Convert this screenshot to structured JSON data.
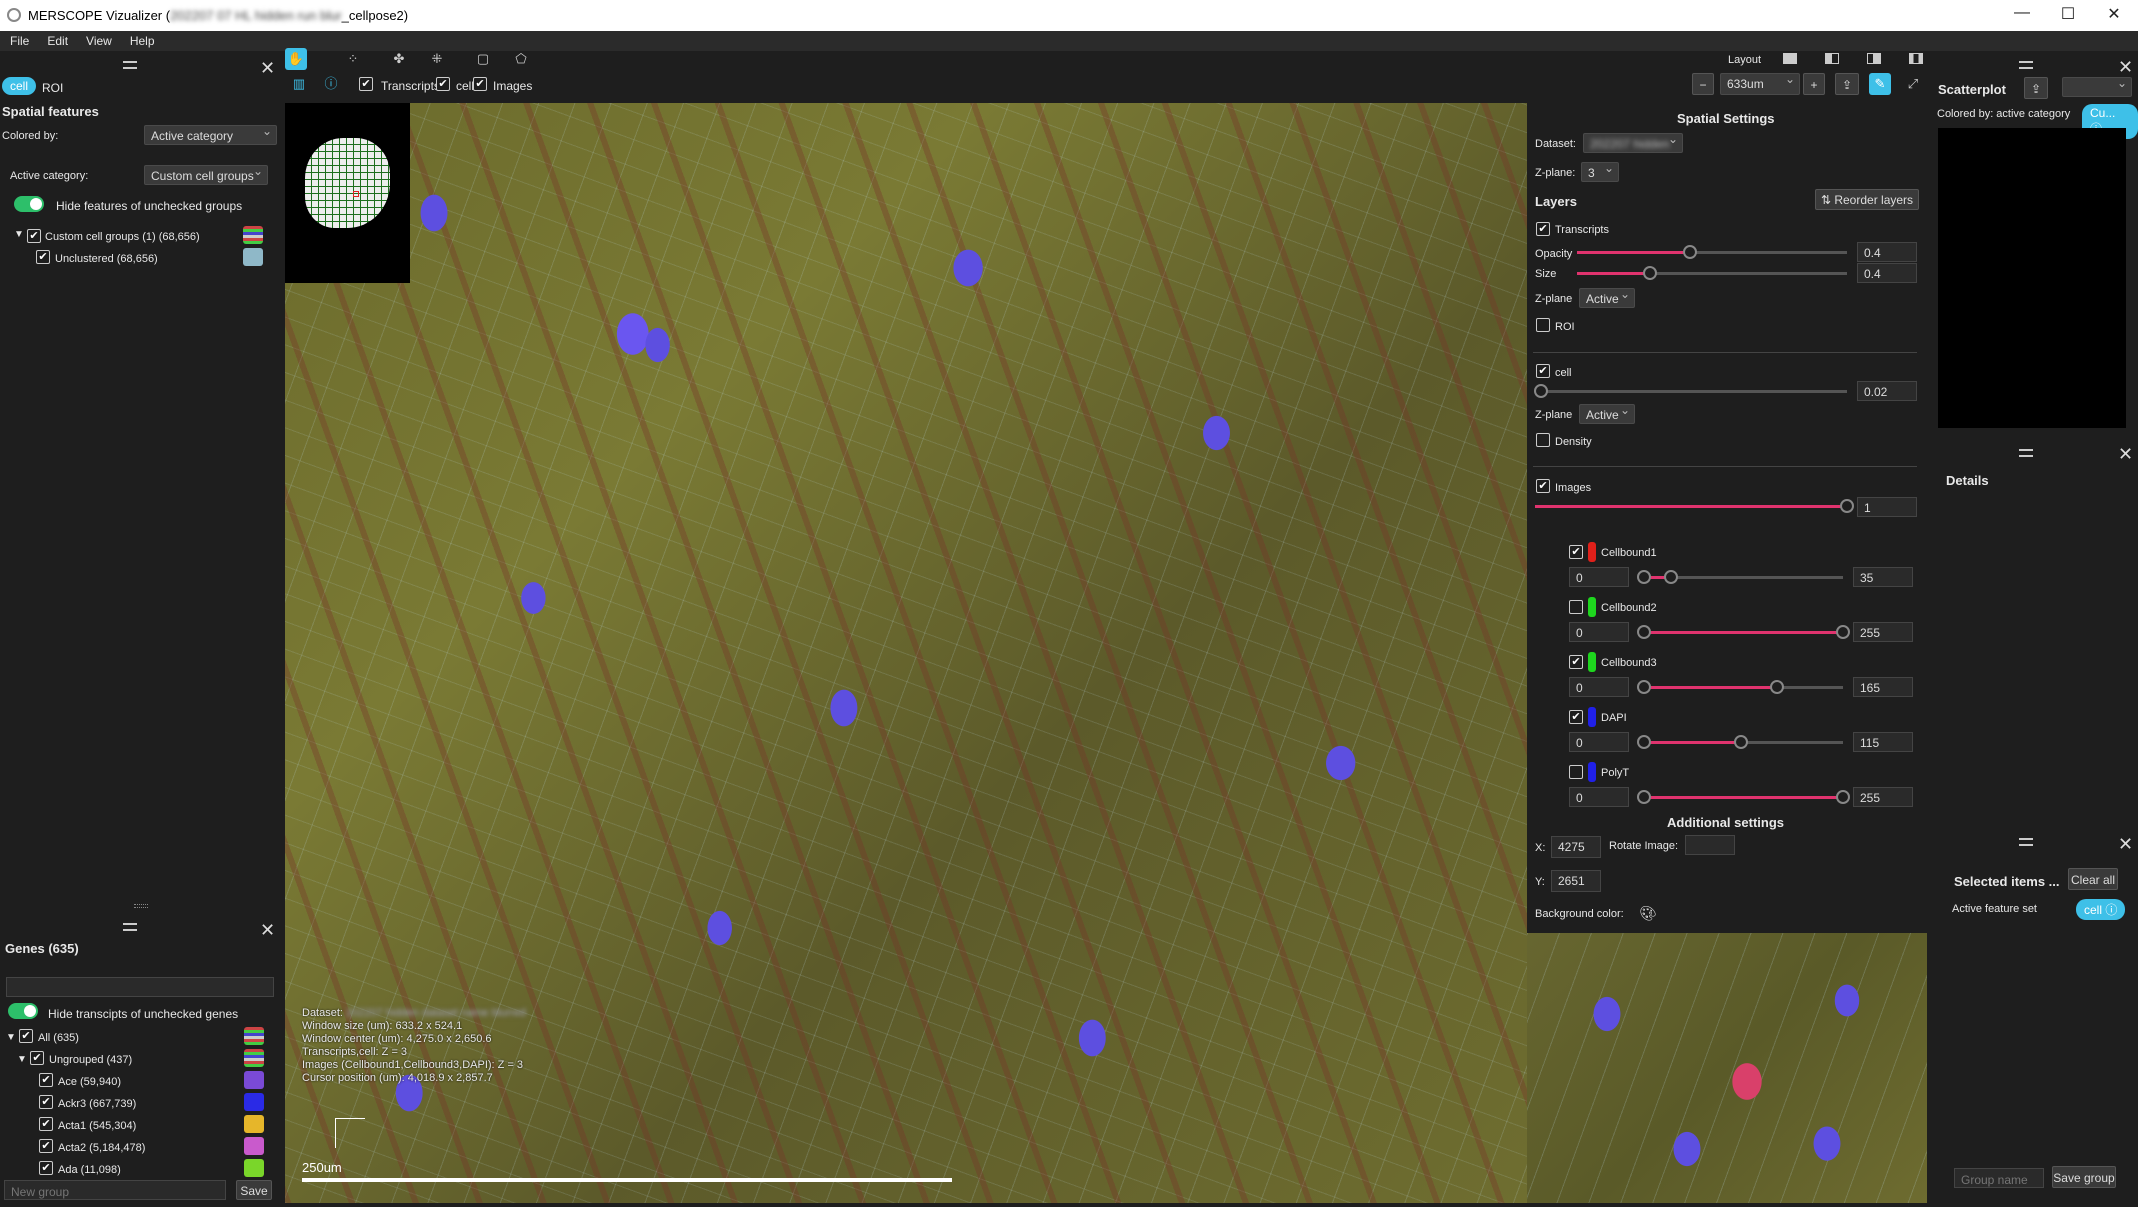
{
  "window": {
    "title_prefix": "MERSCOPE Vizualizer (",
    "title_blurred": "202207 07 HL hidden run blur",
    "title_suffix": "_cellpose2)",
    "minimize": "—",
    "maximize": "☐",
    "close": "✕"
  },
  "menu": [
    "File",
    "Edit",
    "View",
    "Help"
  ],
  "left": {
    "tabs": {
      "cell": "cell",
      "roi": "ROI"
    },
    "spatial_features": "Spatial features",
    "colored_by_label": "Colored by:",
    "colored_by_value": "Active category",
    "active_category_label": "Active category:",
    "active_category_value": "Custom cell groups",
    "hide_features": "Hide features of unchecked groups",
    "tree": [
      {
        "label": "Custom cell groups (1) (68,656)"
      },
      {
        "label": "Unclustered (68,656)",
        "color": "#8fb8c8"
      }
    ]
  },
  "genes": {
    "title": "Genes (635)",
    "search_placeholder": "",
    "hide_label": "Hide transcipts of unchecked genes",
    "rows": [
      {
        "label": "All (635)",
        "color": ""
      },
      {
        "label": "Ungrouped (437)",
        "color": ""
      },
      {
        "label": "Ace (59,940)",
        "color": "#7a4ad6"
      },
      {
        "label": "Ackr3 (667,739)",
        "color": "#2a2ae6"
      },
      {
        "label": "Acta1 (545,304)",
        "color": "#e6b62a"
      },
      {
        "label": "Acta2 (5,184,478)",
        "color": "#c95acc"
      },
      {
        "label": "Ada (11,098)",
        "color": "#7ad62a"
      }
    ],
    "new_group_placeholder": "New group",
    "save": "Save"
  },
  "toolbar": {
    "transcripts": "Transcripts",
    "cell": "cell",
    "images": "Images",
    "layout": "Layout",
    "zoom_value": "633um",
    "minus": "−",
    "plus": "+"
  },
  "viewer": {
    "overlay": [
      {
        "k": "Dataset:",
        "v": "202207 hidden dataset name blurred"
      },
      {
        "k": "Window size (um): 633.2 x 524.1",
        "v": ""
      },
      {
        "k": "Window center (um): 4,275.0 x 2,650.6",
        "v": ""
      },
      {
        "k": "Transcripts,cell: Z = 3",
        "v": ""
      },
      {
        "k": "Images (Cellbound1,Cellbound3,DAPI): Z = 3",
        "v": ""
      },
      {
        "k": "Cursor position (um): 4,018.9 x 2,857.7",
        "v": ""
      }
    ],
    "scale_label": "250um"
  },
  "spatial": {
    "title": "Spatial Settings",
    "dataset_label": "Dataset:",
    "dataset_value": "202207 hidden",
    "zplane_label": "Z-plane:",
    "zplane_value": "3",
    "layers": "Layers",
    "reorder": "Reorder layers",
    "transcripts": {
      "label": "Transcripts",
      "opacity_label": "Opacity",
      "opacity": "0.4",
      "size_label": "Size",
      "size": "0.4",
      "zplane_label": "Z-plane",
      "zplane": "Active",
      "opacity_frac": 0.42,
      "size_frac": 0.27
    },
    "roi": "ROI",
    "cell": {
      "label": "cell",
      "value": "0.02",
      "frac": 0.02,
      "zplane_label": "Z-plane",
      "zplane": "Active"
    },
    "density": "Density",
    "images": {
      "label": "Images",
      "value": "1",
      "frac": 1.0
    },
    "channels": [
      {
        "name": "Cellbound1",
        "color": "#e0201a",
        "checked": true,
        "min": "0",
        "max": "35",
        "frac": 0.14
      },
      {
        "name": "Cellbound2",
        "color": "#1ed61e",
        "checked": false,
        "min": "0",
        "max": "255",
        "frac": 1.0
      },
      {
        "name": "Cellbound3",
        "color": "#1ed61e",
        "checked": true,
        "min": "0",
        "max": "165",
        "frac": 0.67
      },
      {
        "name": "DAPI",
        "color": "#2020e8",
        "checked": true,
        "min": "0",
        "max": "115",
        "frac": 0.49
      },
      {
        "name": "PolyT",
        "color": "#2020e8",
        "checked": false,
        "min": "0",
        "max": "255",
        "frac": 1.0
      }
    ],
    "additional": "Additional settings",
    "x_label": "X:",
    "x": "4275",
    "y_label": "Y:",
    "y": "2651",
    "rotate_label": "Rotate Image:",
    "bg_label": "Background color:"
  },
  "scatter": {
    "title": "Scatterplot",
    "colored_by": "Colored by: active category",
    "pill": "Cu..."
  },
  "details": {
    "title": "Details"
  },
  "selected": {
    "title": "Selected items ...",
    "clear": "Clear all",
    "active_label": "Active feature set",
    "active_pill": "cell",
    "group_placeholder": "Group name",
    "save_group": "Save group"
  }
}
